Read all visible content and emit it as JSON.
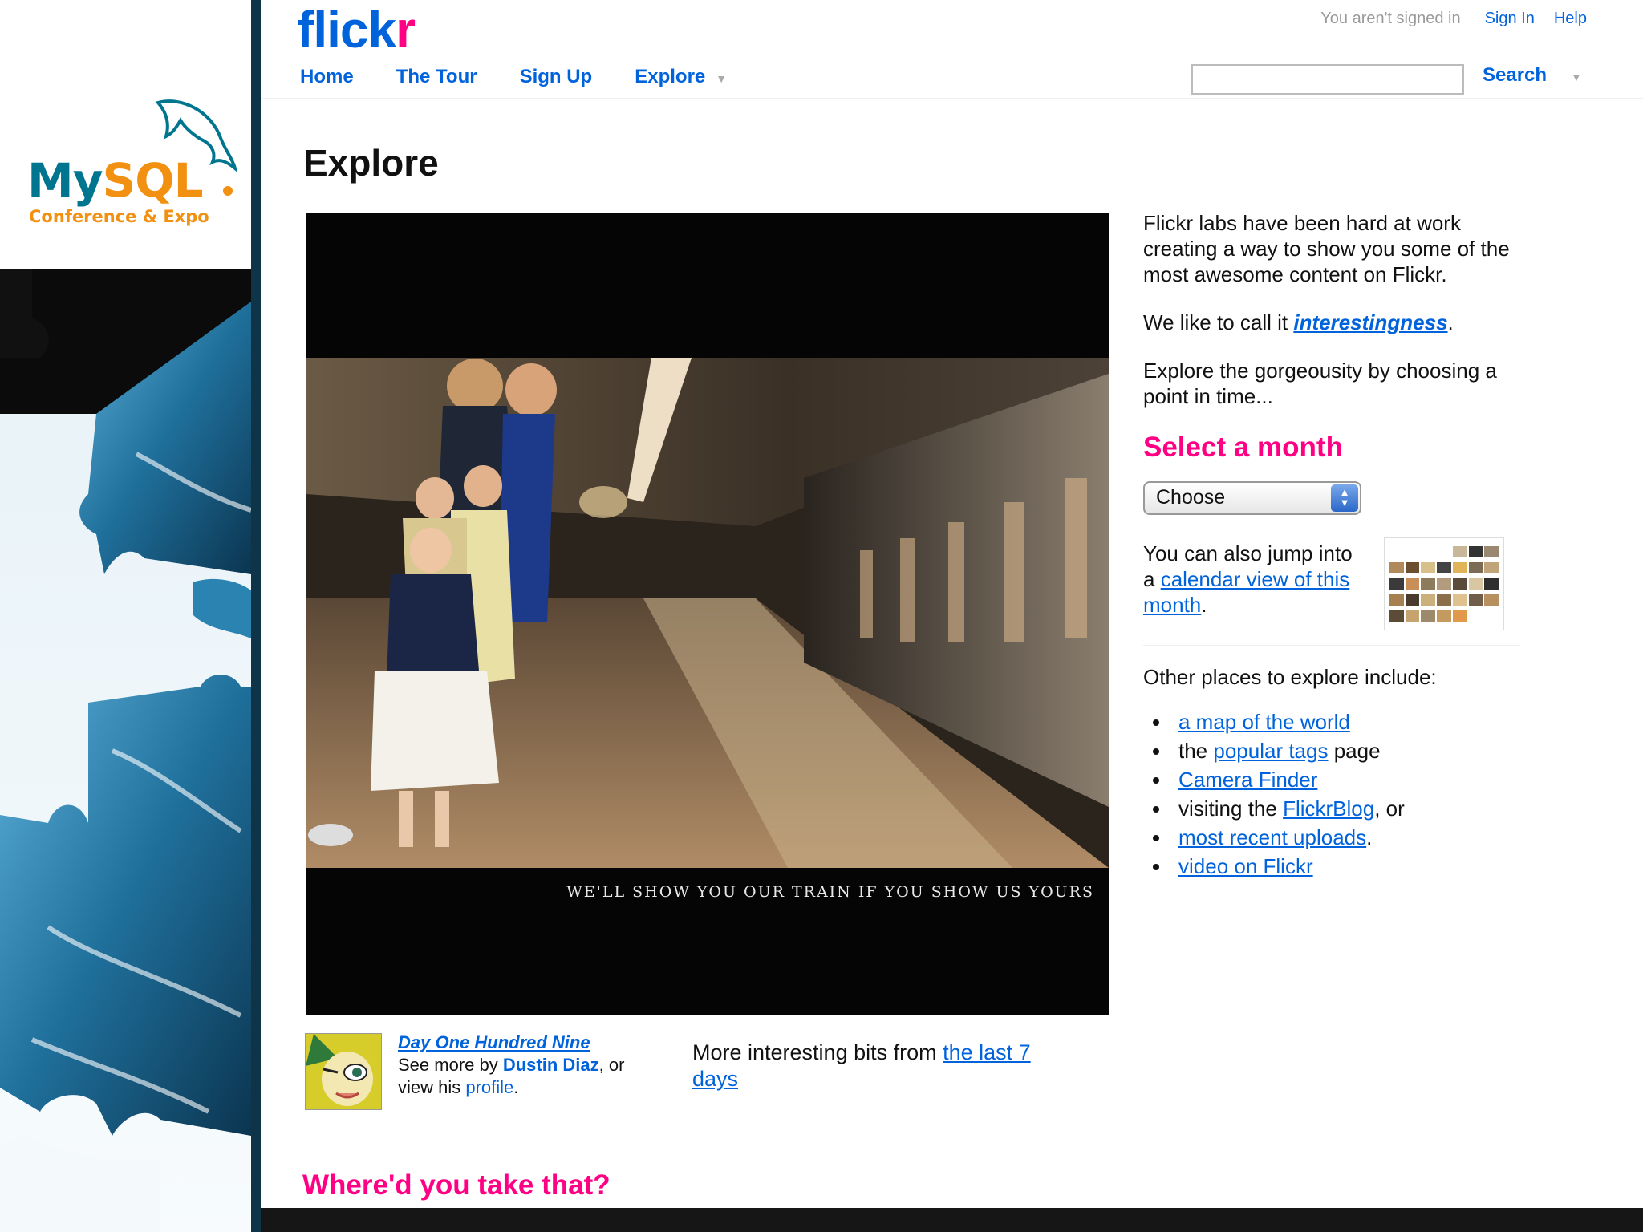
{
  "side_panel": {
    "brand_my": "My",
    "brand_sql": "SQL",
    "brand_sub": "Conference & Expo"
  },
  "header": {
    "logo_part1": "flick",
    "logo_part2": "r",
    "nav": [
      "Home",
      "The Tour",
      "Sign Up",
      "Explore"
    ],
    "signed_in_status": "You aren't signed in",
    "sign_in": "Sign In",
    "help": "Help",
    "search_label": "Search",
    "search_value": ""
  },
  "main": {
    "title": "Explore",
    "photo_caption": "WE'LL SHOW YOU OUR TRAIN IF YOU SHOW US YOURS",
    "photo_title": "Day One Hundred Nine",
    "see_more_prefix": "See more by ",
    "author": "Dustin Diaz",
    "view_mid": ", or view his ",
    "profile": "profile",
    "view_end": ".",
    "more_bits_prefix": "More interesting bits from ",
    "more_bits_link": "the last 7 days",
    "where_heading": "Where'd you take that?"
  },
  "sidebar": {
    "intro": "Flickr labs have been hard at work creating a way to show you some of the most awesome content on Flickr.",
    "call_prefix": "We like to call it ",
    "call_link": "interestingness",
    "call_suffix": ".",
    "explore_text": "Explore the gorgeousity by choosing a point in time...",
    "select_heading": "Select a month",
    "month_select_value": "Choose",
    "jump_prefix": "You can also jump into a ",
    "jump_link": "calendar view of this month",
    "jump_suffix": ".",
    "other_places": "Other places to explore include:",
    "places": {
      "map": "a map of the world",
      "tags_prefix": "the ",
      "tags_link": "popular tags",
      "tags_suffix": " page",
      "camera": "Camera Finder",
      "blog_prefix": "visiting the ",
      "blog_link": "FlickrBlog",
      "blog_suffix": ", or",
      "recent": "most recent uploads",
      "recent_suffix": ".",
      "video": "video on Flickr"
    }
  },
  "colors": {
    "flickr_blue": "#0063dc",
    "flickr_pink": "#ff0084",
    "mysql_blue": "#00758f",
    "mysql_orange": "#f29111"
  }
}
